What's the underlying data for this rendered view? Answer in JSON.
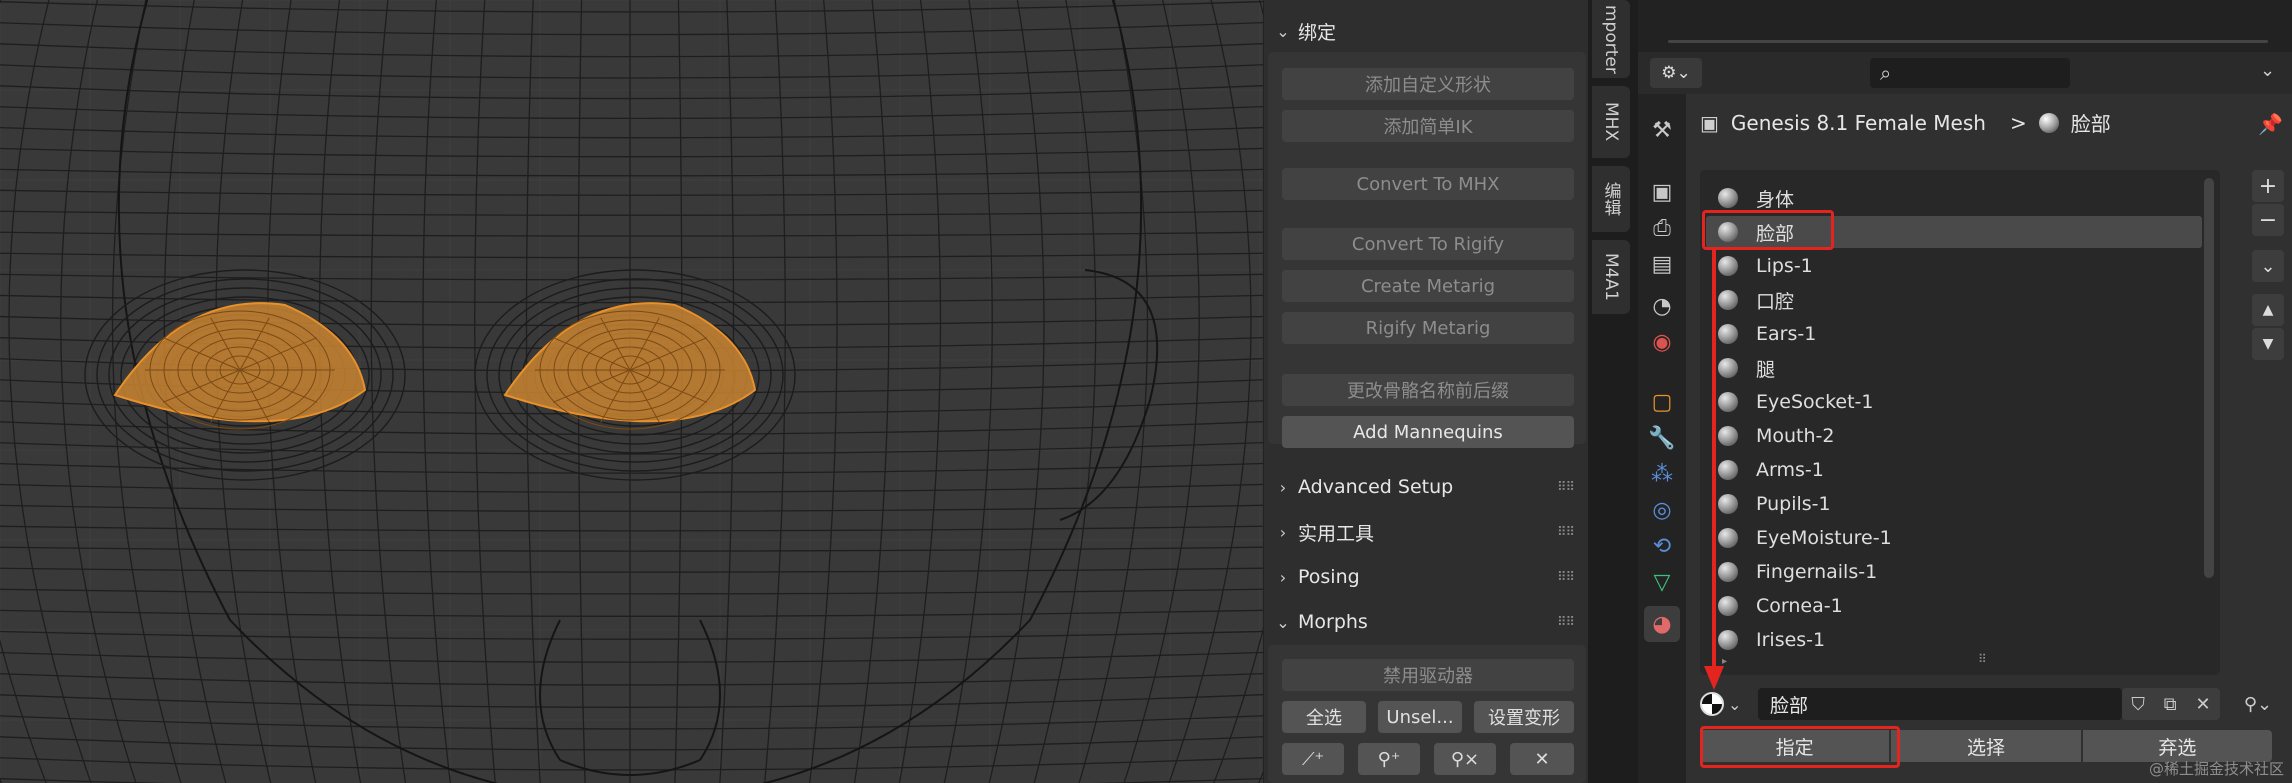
{
  "npanel": {
    "binding_header": "绑定",
    "binding_buttons": [
      "添加自定义形状",
      "添加简单IK",
      "Convert To MHX",
      "Convert To Rigify",
      "Create Metarig",
      "Rigify Metarig",
      "更改骨骼名称前后缀",
      "Add Mannequins"
    ],
    "sections": [
      "Advanced Setup",
      "实用工具",
      "Posing",
      "Morphs"
    ],
    "morphs_buttons": {
      "disable_drivers": "禁用驱动器",
      "select_all": "全选",
      "unselect": "Unsel...",
      "set_morph": "设置变形"
    }
  },
  "vtabs": [
    "mporter",
    "MHX",
    "编辑",
    "M4A1"
  ],
  "properties": {
    "breadcrumb_object": "Genesis 8.1 Female Mesh",
    "breadcrumb_separator": ">",
    "breadcrumb_material": "脸部",
    "material_slots": [
      "身体",
      "脸部",
      "Lips-1",
      "口腔",
      "Ears-1",
      "腿",
      "EyeSocket-1",
      "Mouth-2",
      "Arms-1",
      "Pupils-1",
      "EyeMoisture-1",
      "Fingernails-1",
      "Cornea-1",
      "Irises-1"
    ],
    "selected_slot": "脸部",
    "material_name": "脸部",
    "assign_button": "指定",
    "select_button": "选择",
    "deselect_button": "弃选"
  },
  "watermark": "@稀土掘金技术社区",
  "colors": {
    "highlight_red": "#e4241e",
    "mesh_selected": "#e8912a",
    "viewport_bg": "#393939"
  },
  "icons": [
    "search-icon",
    "pin-icon",
    "plus-icon",
    "minus-icon",
    "chevron-down-icon",
    "arrow-up-icon",
    "arrow-down-icon",
    "shield-icon",
    "copy-icon",
    "close-icon",
    "material-sphere-icon"
  ]
}
